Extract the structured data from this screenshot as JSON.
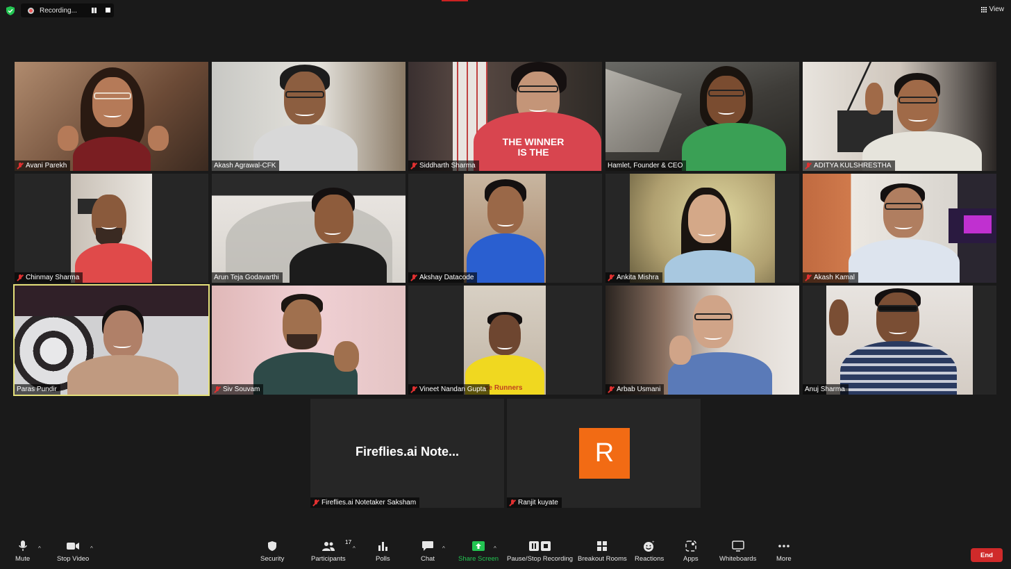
{
  "topbar": {
    "recording_label": "Recording...",
    "view_label": "View"
  },
  "participants": [
    {
      "name": "Avani Parekh",
      "muted": true
    },
    {
      "name": "Akash Agrawal-CFK",
      "muted": false
    },
    {
      "name": "Siddharth Sharma",
      "muted": true
    },
    {
      "name": "Hamlet, Founder & CEO",
      "muted": false
    },
    {
      "name": "ADITYA KULSHRESTHA",
      "muted": true
    },
    {
      "name": "Chinmay Sharma",
      "muted": true
    },
    {
      "name": "Arun Teja Godavarthi",
      "muted": false
    },
    {
      "name": "Akshay Datacode",
      "muted": true
    },
    {
      "name": "Ankita Mishra",
      "muted": true
    },
    {
      "name": "Akash Kamal",
      "muted": true
    },
    {
      "name": "Paras Pundir",
      "muted": false,
      "active_speaker": true
    },
    {
      "name": "Siv Souvam",
      "muted": true
    },
    {
      "name": "Vineet Nandan Gupta",
      "muted": true
    },
    {
      "name": "Arbab Usmani",
      "muted": true
    },
    {
      "name": "Anuj Sharma",
      "muted": false
    },
    {
      "name": "Fireflies.ai Notetaker Saksham",
      "muted": true,
      "display_text": "Fireflies.ai  Note..."
    },
    {
      "name": "Ranjit kuyate",
      "muted": true,
      "avatar_letter": "R",
      "avatar_color": "#f26b14"
    }
  ],
  "shirt_texts": {
    "siddharth": "THE WINNER IS THE",
    "vineet": "ce Runners"
  },
  "toolbar": {
    "mute": "Mute",
    "stop_video": "Stop Video",
    "security": "Security",
    "participants": "Participants",
    "participants_count": "17",
    "polls": "Polls",
    "chat": "Chat",
    "share_screen": "Share Screen",
    "pause_stop_recording": "Pause/Stop Recording",
    "breakout_rooms": "Breakout Rooms",
    "reactions": "Reactions",
    "apps": "Apps",
    "whiteboards": "Whiteboards",
    "more": "More",
    "end": "End"
  },
  "colors": {
    "background": "#1a1a1a",
    "tile": "#262626",
    "active_speaker_border": "#e5e07a",
    "share_green": "#23c552",
    "end_red": "#d02a2a",
    "mute_red": "#e03030"
  }
}
